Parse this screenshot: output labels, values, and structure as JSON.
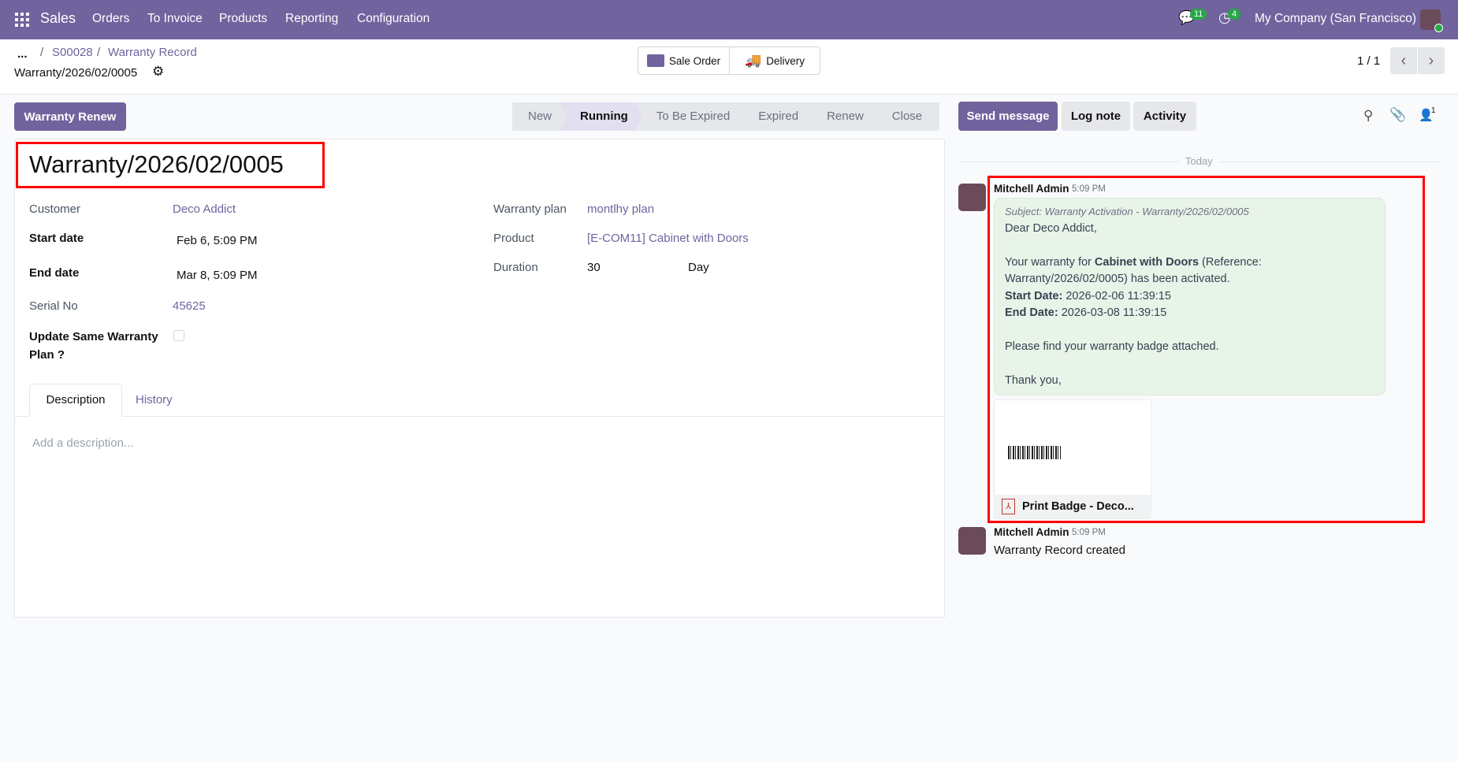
{
  "navbar": {
    "app": "Sales",
    "menu": [
      "Orders",
      "To Invoice",
      "Products",
      "Reporting",
      "Configuration"
    ],
    "messages_count": "11",
    "activities_count": "4",
    "company": "My Company (San Francisco)"
  },
  "breadcrumb": {
    "ellipsis": "...",
    "items": [
      "S00028",
      "Warranty Record"
    ],
    "current": "Warranty/2026/02/0005"
  },
  "smart_buttons": {
    "sale_order": "Sale Order",
    "delivery": "Delivery"
  },
  "pager": {
    "value": "1 / 1"
  },
  "actions": {
    "warranty_renew": "Warranty Renew"
  },
  "statusbar": {
    "stages": [
      "New",
      "Running",
      "To Be Expired",
      "Expired",
      "Renew",
      "Close"
    ],
    "active": "Running"
  },
  "chatter_buttons": {
    "send": "Send message",
    "log": "Log note",
    "activity": "Activity",
    "followers": "1"
  },
  "form": {
    "title": "Warranty/2026/02/0005",
    "left": [
      {
        "label": "Customer",
        "value": "Deco Addict"
      },
      {
        "label": "Start date",
        "value": "Feb 6, 5:09 PM"
      },
      {
        "label": "End date",
        "value": "Mar 8, 5:09 PM"
      },
      {
        "label": "Serial No",
        "value": "45625"
      },
      {
        "label": "Update Same Warranty Plan ?",
        "value": ""
      }
    ],
    "right": [
      {
        "label": "Warranty plan",
        "value": "montlhy plan"
      },
      {
        "label": "Product",
        "value": "[E-COM11] Cabinet with Doors"
      },
      {
        "label": "Duration",
        "value": "30",
        "unit": "Day"
      }
    ],
    "tabs": [
      "Description",
      "History"
    ],
    "description_placeholder": "Add a description..."
  },
  "chatter": {
    "date_sep": "Today",
    "messages": [
      {
        "author": "Mitchell Admin",
        "time": "5:09 PM",
        "subject": "Subject: Warranty Activation - Warranty/2026/02/0005",
        "greeting": "Dear Deco Addict,",
        "line1a": "Your warranty for ",
        "line1b": "Cabinet with Doors",
        "line1c": " (Reference:",
        "line2": "Warranty/2026/02/0005) has been activated.",
        "start_label": "Start Date:",
        "start_value": " 2026-02-06 11:39:15",
        "end_label": "End Date:",
        "end_value": " 2026-03-08 11:39:15",
        "line3": "Please find your warranty badge attached.",
        "closing": "Thank you,",
        "attachment": "Print Badge - Deco..."
      },
      {
        "author": "Mitchell Admin",
        "time": "5:09 PM",
        "body": "Warranty Record created"
      }
    ]
  }
}
